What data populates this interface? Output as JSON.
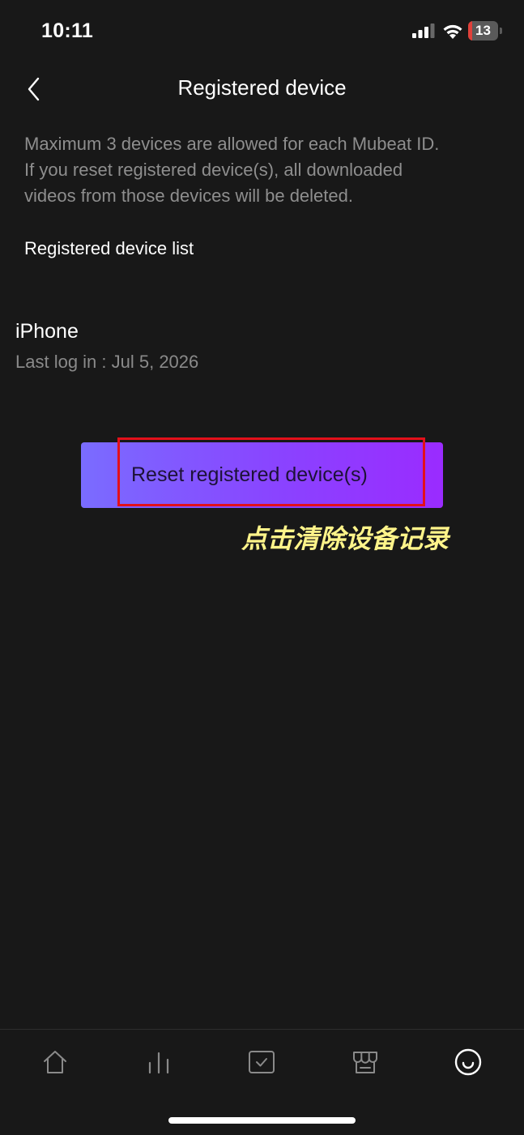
{
  "status_bar": {
    "time": "10:11",
    "battery_level": "13",
    "battery_fraction": 0.13,
    "icons": [
      "signal-icon",
      "wifi-icon",
      "battery-icon"
    ]
  },
  "header": {
    "title": "Registered device",
    "back_icon": "chevron-left-icon"
  },
  "notice": {
    "lines": [
      "Maximum 3 devices are allowed for each Mubeat ID.",
      "If you reset registered device(s), all downloaded",
      "videos from those devices will be deleted."
    ]
  },
  "device_list": {
    "title": "Registered device list",
    "devices": [
      {
        "name": "iPhone",
        "last_login": "Last log in : Jul 5, 2026"
      }
    ]
  },
  "reset_button": {
    "label": "Reset registered device(s)"
  },
  "annotation": {
    "text": "点击清除设备记录",
    "color": "#fff48a",
    "highlight_color": "#e3101a"
  },
  "tab_bar": {
    "tabs": [
      {
        "name": "home",
        "icon": "home-icon"
      },
      {
        "name": "chart",
        "icon": "bar-chart-icon"
      },
      {
        "name": "vote",
        "icon": "checkbox-icon"
      },
      {
        "name": "store",
        "icon": "store-icon"
      },
      {
        "name": "my",
        "icon": "smiley-icon",
        "active": true
      }
    ]
  },
  "colors": {
    "background": "#181818",
    "button_gradient_start": "#7a6cff",
    "button_gradient_end": "#9a2bff",
    "muted_text": "#8e8e8e"
  }
}
